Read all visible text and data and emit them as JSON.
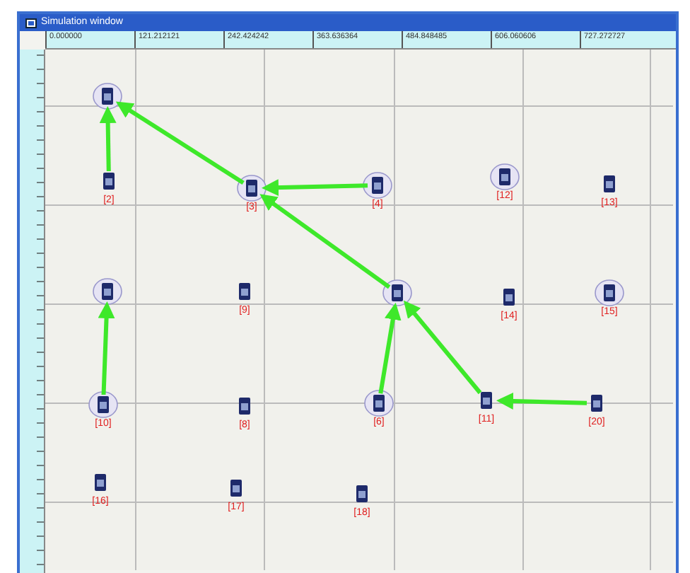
{
  "window": {
    "title": "Simulation window"
  },
  "ruler": {
    "x_labels": [
      "0.000000",
      "121.212121",
      "242.424242",
      "363.636364",
      "484.848485",
      "606.060606",
      "727.272727"
    ]
  },
  "nodes": [
    {
      "circled": true
    },
    {
      "label": "[2]",
      "circled": false,
      "sends": true
    },
    {
      "label": "[3]",
      "circled": true,
      "sends": true
    },
    {
      "label": "[4]",
      "circled": true,
      "sends": true
    },
    {
      "label": "[12]",
      "circled": true
    },
    {
      "label": "[13]",
      "circled": false
    },
    {
      "circled": true
    },
    {
      "label": "[9]",
      "circled": false
    },
    {
      "circled": true,
      "sends": true
    },
    {
      "label": "[14]",
      "circled": false
    },
    {
      "label": "[15]",
      "circled": true
    },
    {
      "label": "[10]",
      "circled": true,
      "sends": true
    },
    {
      "label": "[8]",
      "circled": false
    },
    {
      "label": "[6]",
      "circled": true,
      "sends": true
    },
    {
      "label": "[11]",
      "circled": false,
      "sends": true
    },
    {
      "label": "[20]",
      "circled": false,
      "sends": true
    },
    {
      "label": "[16]",
      "circled": false
    },
    {
      "label": "[17]",
      "circled": false
    },
    {
      "label": "[18]",
      "circled": false
    }
  ]
}
